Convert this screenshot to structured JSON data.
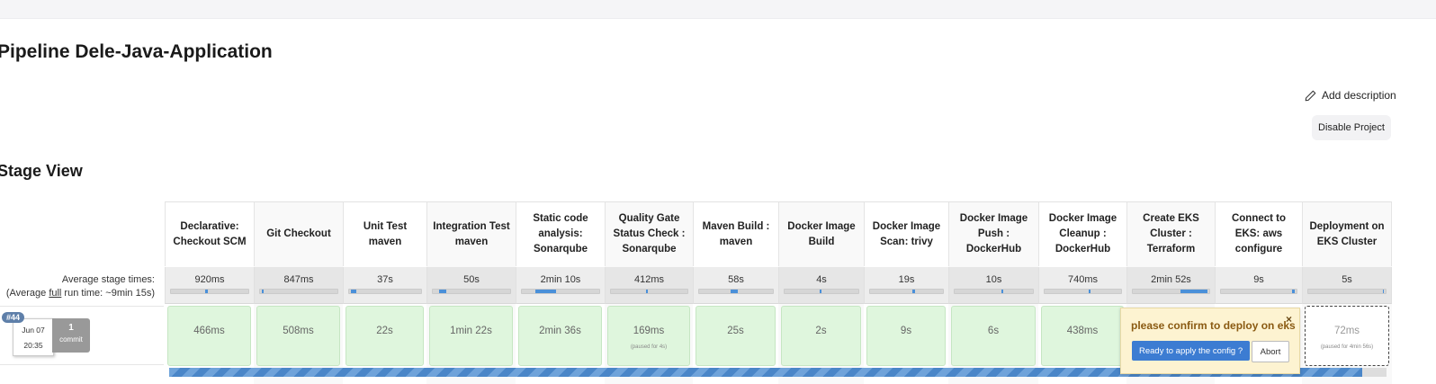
{
  "page": {
    "title": "Pipeline Dele-Java-Application",
    "add_description": "Add description",
    "disable_project": "Disable Project"
  },
  "stage_view": {
    "title": "Stage View",
    "avg_stage_times": "Average stage times:",
    "avg_run_prefix": "(Average ",
    "avg_run_link": "full",
    "avg_run_suffix": " run time: ~9min 15s)",
    "stages": [
      {
        "name": "Declarative: Checkout SCM",
        "avg": "920ms",
        "duration": "466ms",
        "paused": ""
      },
      {
        "name": "Git Checkout",
        "avg": "847ms",
        "duration": "508ms",
        "paused": ""
      },
      {
        "name": "Unit Test maven",
        "avg": "37s",
        "duration": "22s",
        "paused": ""
      },
      {
        "name": "Integration Test maven",
        "avg": "50s",
        "duration": "1min 22s",
        "paused": ""
      },
      {
        "name": "Static code analysis: Sonarqube",
        "avg": "2min 10s",
        "duration": "2min 36s",
        "paused": ""
      },
      {
        "name": "Quality Gate Status Check : Sonarqube",
        "avg": "412ms",
        "duration": "169ms",
        "paused": "(paused for 4s)"
      },
      {
        "name": "Maven Build : maven",
        "avg": "58s",
        "duration": "25s",
        "paused": ""
      },
      {
        "name": "Docker Image Build",
        "avg": "4s",
        "duration": "2s",
        "paused": ""
      },
      {
        "name": "Docker Image Scan: trivy",
        "avg": "19s",
        "duration": "9s",
        "paused": ""
      },
      {
        "name": "Docker Image Push : DockerHub",
        "avg": "10s",
        "duration": "6s",
        "paused": ""
      },
      {
        "name": "Docker Image Cleanup : DockerHub",
        "avg": "740ms",
        "duration": "438ms",
        "paused": ""
      },
      {
        "name": "Create EKS Cluster : Terraform",
        "avg": "2min 52s",
        "duration": "",
        "paused": ""
      },
      {
        "name": "Connect to EKS: aws configure",
        "avg": "9s",
        "duration": "",
        "paused": ""
      },
      {
        "name": "Deployment on EKS Cluster",
        "avg": "5s",
        "duration": "72ms",
        "paused": "(paused for 4min 56s)"
      }
    ]
  },
  "run": {
    "badge": "#44",
    "date": "Jun 07",
    "time": "20:35",
    "commits_count": "1",
    "commits_label": "commit",
    "progress": 0.98
  },
  "input_popup": {
    "message": "please confirm to deploy on eks",
    "close": "×",
    "confirm": "Ready to apply the config ?",
    "abort": "Abort"
  },
  "colors": {
    "success_cell": "#dff6dd",
    "progress_blue": "#4a86c8",
    "popup_bg": "#fdf3d1",
    "confirm_button": "#3c7cd2"
  }
}
